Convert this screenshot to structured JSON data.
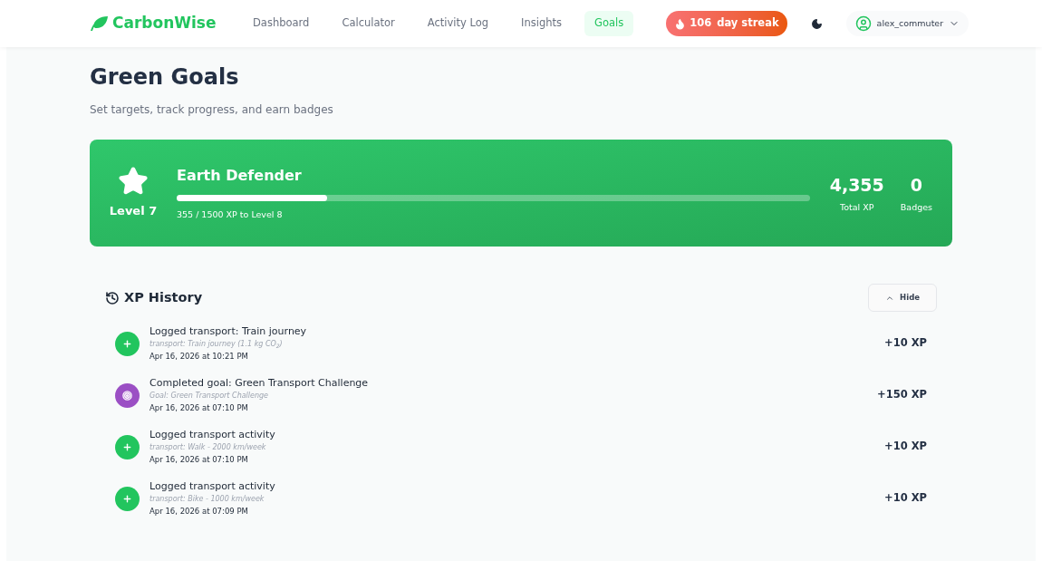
{
  "brand": "CarbonWise",
  "nav": [
    {
      "label": "Dashboard",
      "selected": false
    },
    {
      "label": "Calculator",
      "selected": false
    },
    {
      "label": "Activity Log",
      "selected": false
    },
    {
      "label": "Insights",
      "selected": false
    },
    {
      "label": "Goals",
      "selected": true
    }
  ],
  "streak": {
    "count": "106",
    "label": "day streak"
  },
  "user": {
    "name": "alex_commuter"
  },
  "page": {
    "title": "Green Goals",
    "subtitle": "Set targets, track progress, and earn badges"
  },
  "level_card": {
    "level": "Level 7",
    "title": "Earth Defender",
    "progress": {
      "level": 0.237
    },
    "progress_text": "355 / 1500 XP to Level 8",
    "stats": [
      {
        "value": "4,355",
        "label": "Total XP"
      },
      {
        "value": "0",
        "label": "Badges"
      }
    ]
  },
  "history": {
    "title": "XP History",
    "toggle": "Hide",
    "expanded": true,
    "items": [
      {
        "kind": "activity",
        "title": "Logged transport: Train journey",
        "detail": "transport: Train journey (1.1 kg CO$_{2}$)",
        "time": "Apr 16, 2026 at 10:21 PM",
        "xp": "+10 XP"
      },
      {
        "kind": "goal",
        "title": "Completed goal: Green Transport Challenge",
        "detail": "Goal: Green Transport Challenge",
        "time": "Apr 16, 2026 at 07:10 PM",
        "xp": "+150 XP"
      },
      {
        "kind": "activity",
        "title": "Logged transport activity",
        "detail": "transport: Walk - 2000 km/week",
        "time": "Apr 16, 2026 at 07:10 PM",
        "xp": "+10 XP"
      },
      {
        "kind": "activity",
        "title": "Logged transport activity",
        "detail": "transport: Bike - 1000 km/week",
        "time": "Apr 16, 2026 at 07:09 PM",
        "xp": "+10 XP"
      }
    ]
  }
}
